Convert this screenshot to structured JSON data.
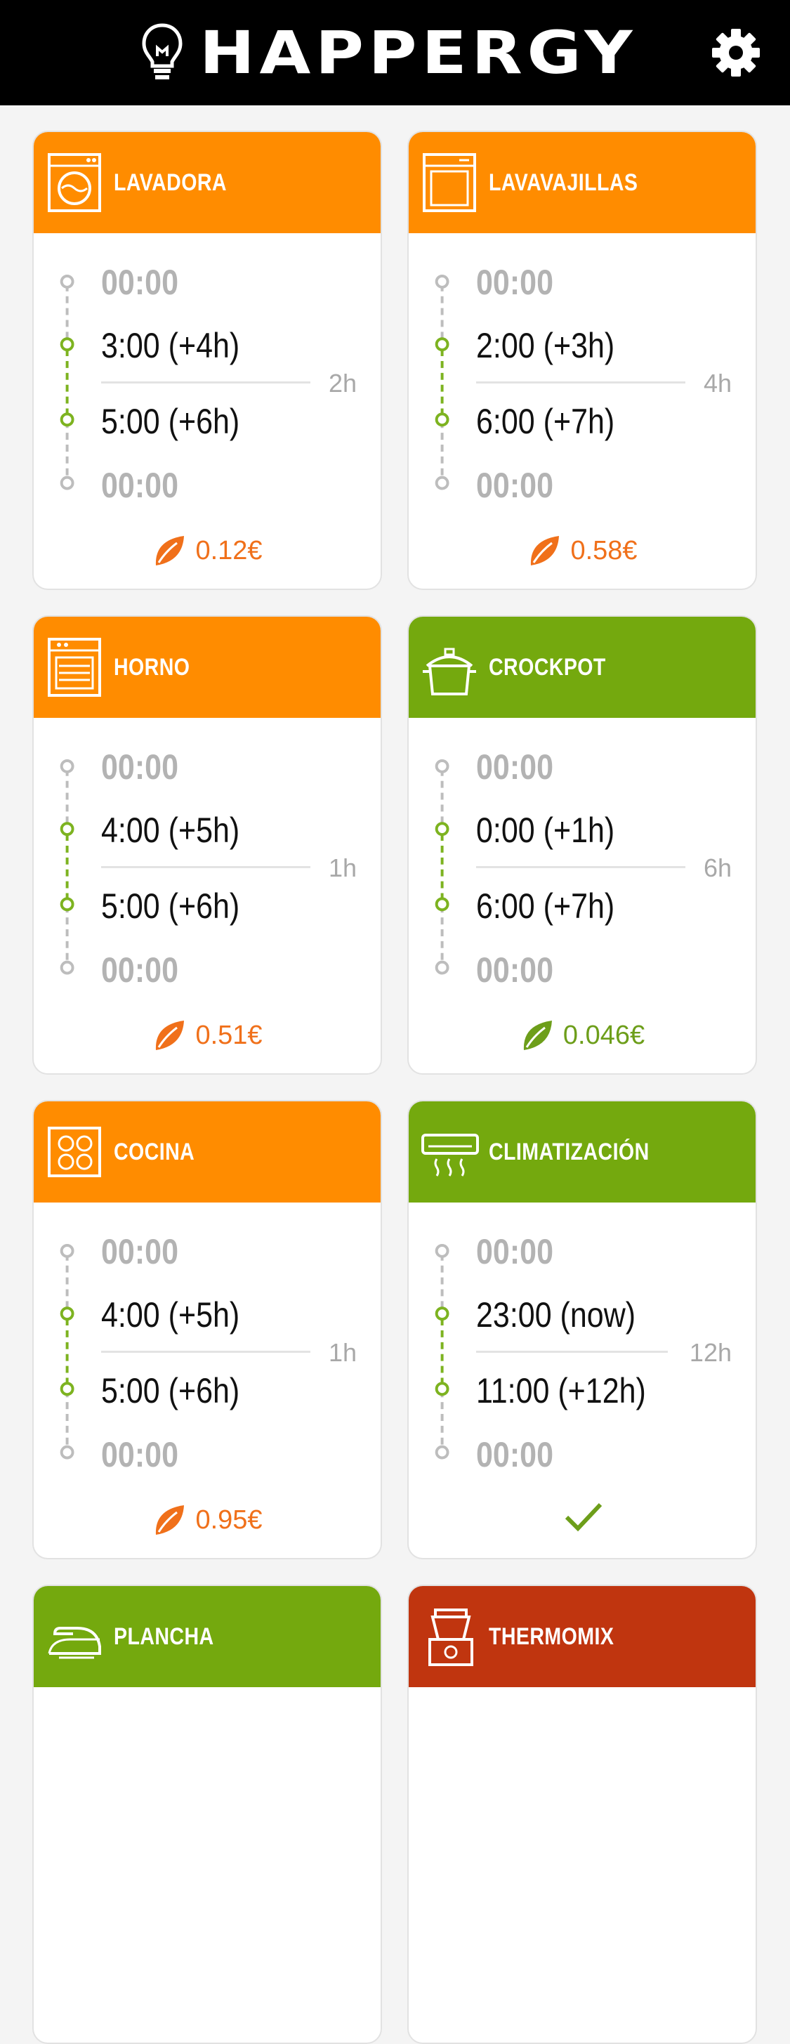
{
  "app": {
    "name": "HAPPERGY",
    "logo_icon": "lightbulb-icon",
    "settings_icon": "gear-icon"
  },
  "colors": {
    "orange": "#ff8c00",
    "green": "#74a90e",
    "red": "#c0350f",
    "cost_orange": "#f0701a",
    "cost_green": "#6d9e1a",
    "rail_grey": "#bdbdbd",
    "rail_green": "#7db320"
  },
  "appliances": [
    {
      "name": "LAVADORA",
      "icon": "washing-machine-icon",
      "color": "orange",
      "start": "00:00",
      "from": "3:00 (+4h)",
      "to": "5:00 (+6h)",
      "end": "00:00",
      "duration": "2h",
      "cost": "0.12€",
      "status": "cost",
      "cost_color": "cost_orange"
    },
    {
      "name": "LAVAVAJILLAS",
      "icon": "dishwasher-icon",
      "color": "orange",
      "start": "00:00",
      "from": "2:00 (+3h)",
      "to": "6:00 (+7h)",
      "end": "00:00",
      "duration": "4h",
      "cost": "0.58€",
      "status": "cost",
      "cost_color": "cost_orange"
    },
    {
      "name": "HORNO",
      "icon": "oven-icon",
      "color": "orange",
      "start": "00:00",
      "from": "4:00 (+5h)",
      "to": "5:00 (+6h)",
      "end": "00:00",
      "duration": "1h",
      "cost": "0.51€",
      "status": "cost",
      "cost_color": "cost_orange"
    },
    {
      "name": "CROCKPOT",
      "icon": "crockpot-icon",
      "color": "green",
      "start": "00:00",
      "from": "0:00 (+1h)",
      "to": "6:00 (+7h)",
      "end": "00:00",
      "duration": "6h",
      "cost": "0.046€",
      "status": "cost",
      "cost_color": "cost_green"
    },
    {
      "name": "COCINA",
      "icon": "cooktop-icon",
      "color": "orange",
      "start": "00:00",
      "from": "4:00 (+5h)",
      "to": "5:00 (+6h)",
      "end": "00:00",
      "duration": "1h",
      "cost": "0.95€",
      "status": "cost",
      "cost_color": "cost_orange"
    },
    {
      "name": "CLIMATIZACIÓN",
      "icon": "air-conditioner-icon",
      "color": "green",
      "start": "00:00",
      "from": "23:00 (now)",
      "to": "11:00 (+12h)",
      "end": "00:00",
      "duration": "12h",
      "cost": "",
      "status": "check",
      "cost_color": "cost_green"
    },
    {
      "name": "PLANCHA",
      "icon": "iron-icon",
      "color": "green",
      "start": "",
      "from": "",
      "to": "",
      "end": "",
      "duration": "",
      "cost": "",
      "status": "none"
    },
    {
      "name": "THERMOMIX",
      "icon": "thermomix-icon",
      "color": "red",
      "start": "",
      "from": "",
      "to": "",
      "end": "",
      "duration": "",
      "cost": "",
      "status": "none"
    }
  ]
}
